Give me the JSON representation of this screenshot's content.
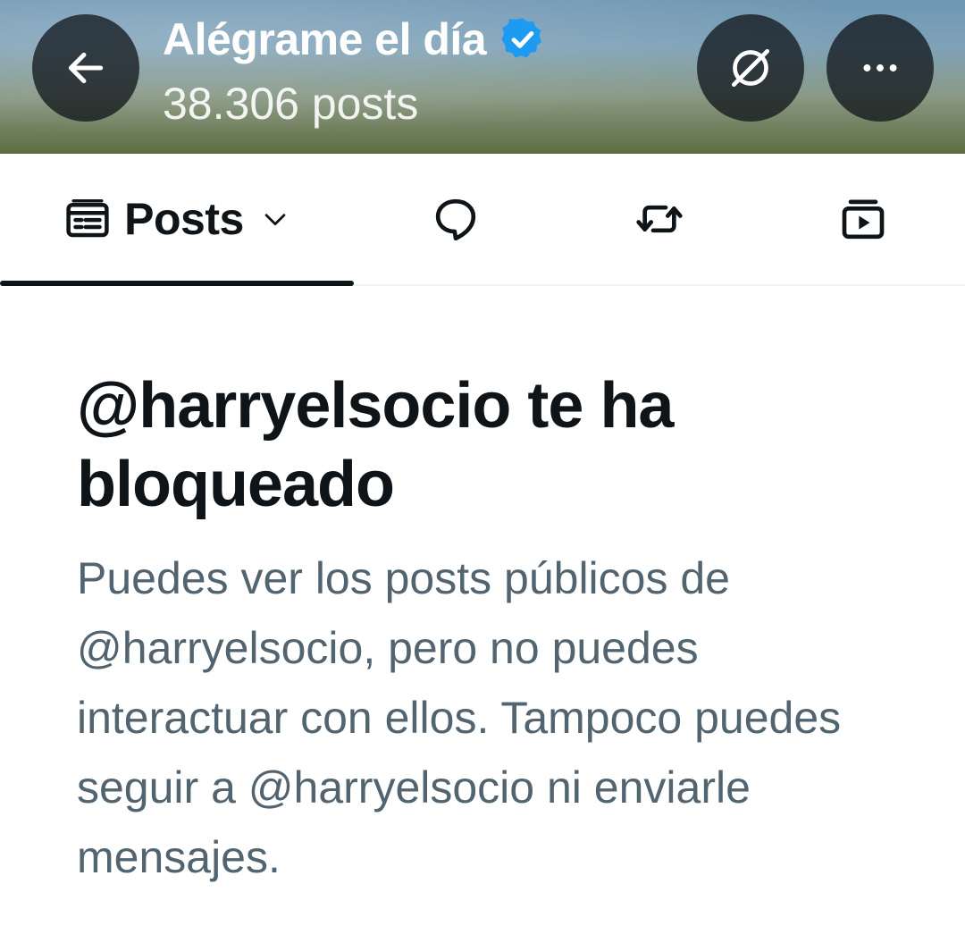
{
  "header": {
    "title": "Alégrame el día",
    "post_count": "38.306 posts",
    "verified": true,
    "accent_color": "#1d9bf0",
    "icons": [
      "arrow-left-icon",
      "grok-icon",
      "more-icon"
    ]
  },
  "tabs": [
    {
      "label": "Posts",
      "icon": "timeline-icon",
      "dropdown": true,
      "selected": true
    },
    {
      "label": "",
      "icon": "reply-icon",
      "selected": false
    },
    {
      "label": "",
      "icon": "repost-icon",
      "selected": false
    },
    {
      "label": "",
      "icon": "media-icon",
      "selected": false
    }
  ],
  "blocked": {
    "title": "@harryelsocio te ha bloqueado",
    "message": "Puedes ver los posts públicos de @harryelsocio, pero no puedes interactuar con ellos. Tampoco puedes seguir a @harryelsocio ni enviarle mensajes."
  },
  "colors": {
    "text_primary": "#0f1419",
    "text_secondary": "#536471",
    "divider": "#eff3f4"
  }
}
